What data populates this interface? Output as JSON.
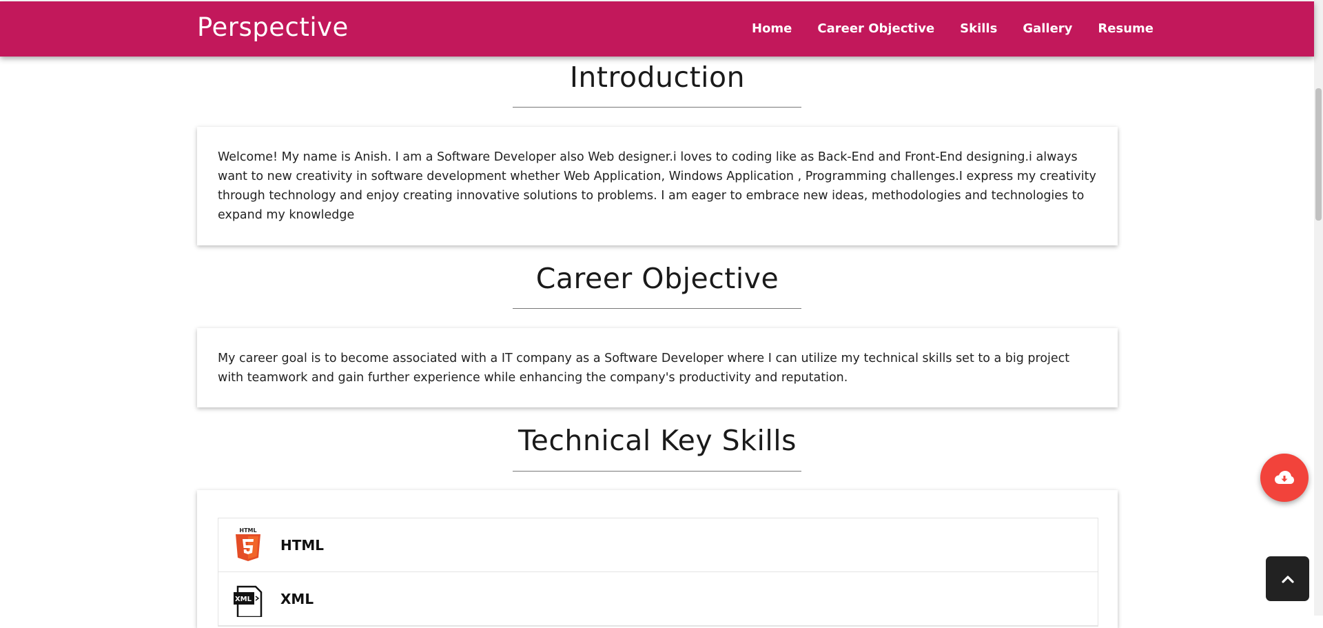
{
  "navbar": {
    "brand": "Perspective",
    "links": [
      "Home",
      "Career Objective",
      "Skills",
      "Gallery",
      "Resume"
    ]
  },
  "introduction": {
    "title": "Introduction",
    "text": "Welcome! My name is Anish. I am a Software Developer also Web designer.i loves to coding like as Back-End and Front-End designing.i always want to new creativity in software development whether Web Application, Windows Application , Programming challenges.I express my creativity through technology and enjoy creating innovative solutions to problems. I am eager to embrace new ideas, methodologies and technologies to expand my knowledge"
  },
  "career": {
    "title": "Career Objective",
    "text": "My career goal is to become associated with a IT company as a Software Developer where I can utilize my technical skills set to a big project with teamwork and gain further experience while enhancing the company's productivity and reputation."
  },
  "skills": {
    "title": "Technical Key Skills",
    "items": [
      {
        "label": "HTML",
        "icon": "html5-icon",
        "icon_text": "HTML"
      },
      {
        "label": "XML",
        "icon": "xml-file-icon",
        "icon_text": "XML"
      }
    ]
  },
  "colors": {
    "navbar": "#c2185b",
    "download_button": "#f2433b",
    "back_to_top": "#222222"
  },
  "floating": {
    "download_icon": "cloud-download-icon",
    "back_to_top_icon": "chevron-up-icon"
  }
}
